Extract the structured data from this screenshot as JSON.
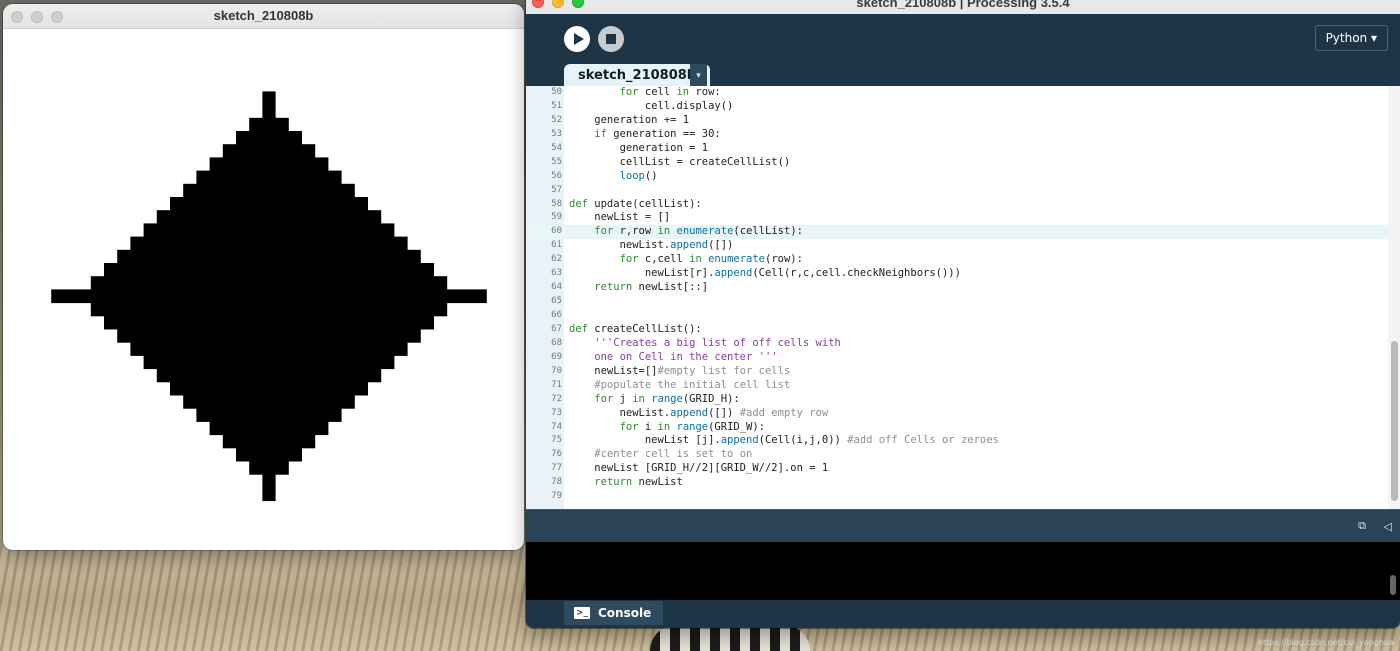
{
  "sketch_window": {
    "title": "sketch_210808b"
  },
  "ide": {
    "title": "sketch_210808b | Processing 3.5.4",
    "mode": "Python ▾",
    "tab": "sketch_210808b",
    "tab_menu": "▾",
    "console_label": "Console",
    "terminal_glyph": ">_",
    "copy_glyph": "⧉",
    "collapse_glyph": "◁",
    "active_line": 60,
    "code": [
      {
        "n": "50",
        "t": "        for cell in row:"
      },
      {
        "n": "51",
        "t": "            cell.display()"
      },
      {
        "n": "52",
        "t": "    generation += 1"
      },
      {
        "n": "53",
        "t": "    if generation == 30:"
      },
      {
        "n": "54",
        "t": "        generation = 1"
      },
      {
        "n": "55",
        "t": "        cellList = createCellList()"
      },
      {
        "n": "56",
        "t": "        loop()"
      },
      {
        "n": "57",
        "t": ""
      },
      {
        "n": "58",
        "t": "def update(cellList):"
      },
      {
        "n": "59",
        "t": "    newList = []"
      },
      {
        "n": "60",
        "t": "    for r,row in enumerate(cellList):"
      },
      {
        "n": "61",
        "t": "        newList.append([])"
      },
      {
        "n": "62",
        "t": "        for c,cell in enumerate(row):"
      },
      {
        "n": "63",
        "t": "            newList[r].append(Cell(r,c,cell.checkNeighbors()))"
      },
      {
        "n": "64",
        "t": "    return newList[::]"
      },
      {
        "n": "65",
        "t": ""
      },
      {
        "n": "66",
        "t": ""
      },
      {
        "n": "67",
        "t": "def createCellList():"
      },
      {
        "n": "68",
        "t": "    '''Creates a big list of off cells with"
      },
      {
        "n": "69",
        "t": "    one on Cell in the center '''"
      },
      {
        "n": "70",
        "t": "    newList=[]#empty list for cells"
      },
      {
        "n": "71",
        "t": "    #populate the initial cell list"
      },
      {
        "n": "72",
        "t": "    for j in range(GRID_H):"
      },
      {
        "n": "73",
        "t": "        newList.append([]) #add empty row"
      },
      {
        "n": "74",
        "t": "        for i in range(GRID_W):"
      },
      {
        "n": "75",
        "t": "            newList [j].append(Cell(i,j,0)) #add off Cells or zeroes"
      },
      {
        "n": "76",
        "t": "    #center cell is set to on"
      },
      {
        "n": "77",
        "t": "    newList [GRID_H//2][GRID_W//2].on = 1"
      },
      {
        "n": "78",
        "t": "    return newList"
      },
      {
        "n": "79",
        "t": ""
      }
    ]
  },
  "watermark": "https://blog.csdn.net/cui_yonghua",
  "colors": {
    "keyword": "#2f8a2b",
    "builtin": "#0d6ea5",
    "string": "#8a3ca0",
    "comment": "#8e8e8e",
    "ide_bg": "#1e3547"
  }
}
